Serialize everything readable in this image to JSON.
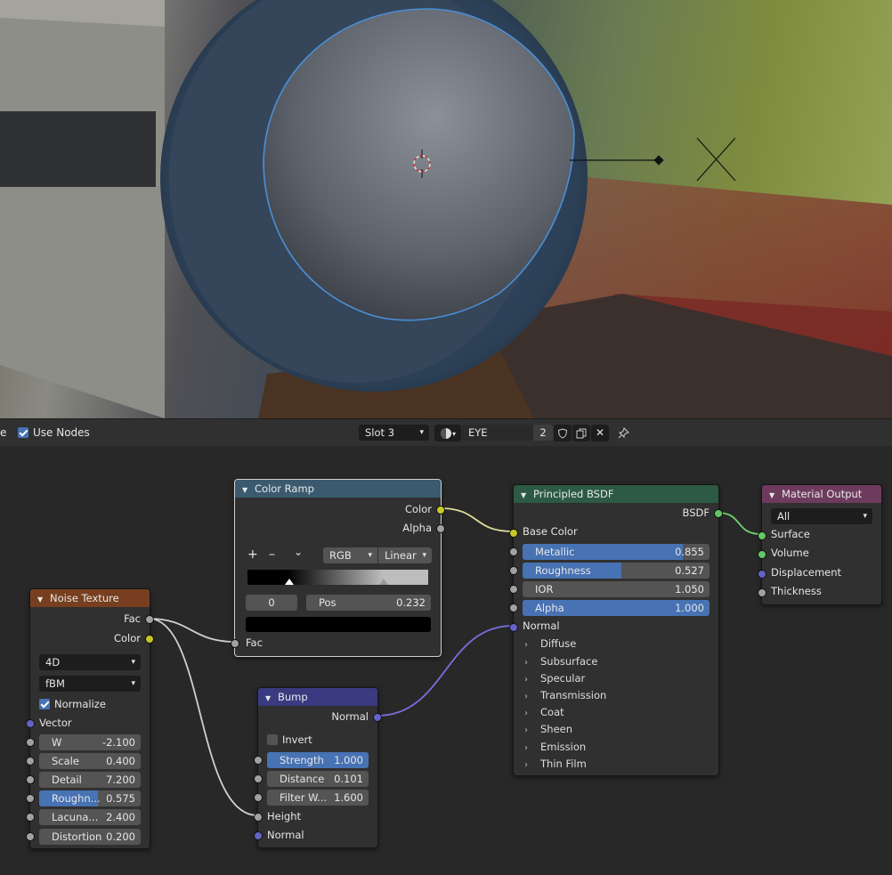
{
  "toolbar": {
    "left_clip": "e",
    "use_nodes_label": "Use Nodes",
    "slot": "Slot 3",
    "material_name": "EYE",
    "user_count": "2"
  },
  "nodes": {
    "color_ramp": {
      "title": "Color Ramp",
      "out_color": "Color",
      "out_alpha": "Alpha",
      "add": "+",
      "remove": "–",
      "menu": "⌄",
      "mode": "RGB",
      "interp": "Linear",
      "index": "0",
      "pos_label": "Pos",
      "pos_value": "0.232",
      "in_fac": "Fac"
    },
    "principled": {
      "title": "Principled BSDF",
      "out_bsdf": "BSDF",
      "base_color": "Base Color",
      "metallic_label": "Metallic",
      "metallic_value": "0.855",
      "metallic": 0.855,
      "roughness_label": "Roughness",
      "roughness_value": "0.527",
      "roughness": 0.527,
      "ior_label": "IOR",
      "ior_value": "1.050",
      "alpha_label": "Alpha",
      "alpha_value": "1.000",
      "alpha": 1.0,
      "normal": "Normal",
      "panels": [
        "Diffuse",
        "Subsurface",
        "Specular",
        "Transmission",
        "Coat",
        "Sheen",
        "Emission",
        "Thin Film"
      ]
    },
    "output": {
      "title": "Material Output",
      "target": "All",
      "surface": "Surface",
      "volume": "Volume",
      "displacement": "Displacement",
      "thickness": "Thickness"
    },
    "noise": {
      "title": "Noise Texture",
      "out_fac": "Fac",
      "out_color": "Color",
      "dimensions": "4D",
      "type": "fBM",
      "normalize": "Normalize",
      "vector": "Vector",
      "w_label": "W",
      "w_value": "-2.100",
      "scale_label": "Scale",
      "scale_value": "0.400",
      "detail_label": "Detail",
      "detail_value": "7.200",
      "roughness_label": "Roughn...",
      "roughness_value": "0.575",
      "roughness": 0.575,
      "lacunarity_label": "Lacuna...",
      "lacunarity_value": "2.400",
      "distortion_label": "Distortion",
      "distortion_value": "0.200"
    },
    "bump": {
      "title": "Bump",
      "out_normal": "Normal",
      "invert": "Invert",
      "strength_label": "Strength",
      "strength_value": "1.000",
      "strength": 1.0,
      "distance_label": "Distance",
      "distance_value": "0.101",
      "filter_label": "Filter W...",
      "filter_value": "1.600",
      "height": "Height",
      "normal": "Normal"
    }
  },
  "colors": {
    "color_ramp_header": "#3b5a6f",
    "principled_header": "#2c5a44",
    "output_header": "#6e3b5e",
    "noise_header": "#773f1f",
    "bump_header": "#3a3a80",
    "accent": "#4772b3"
  }
}
